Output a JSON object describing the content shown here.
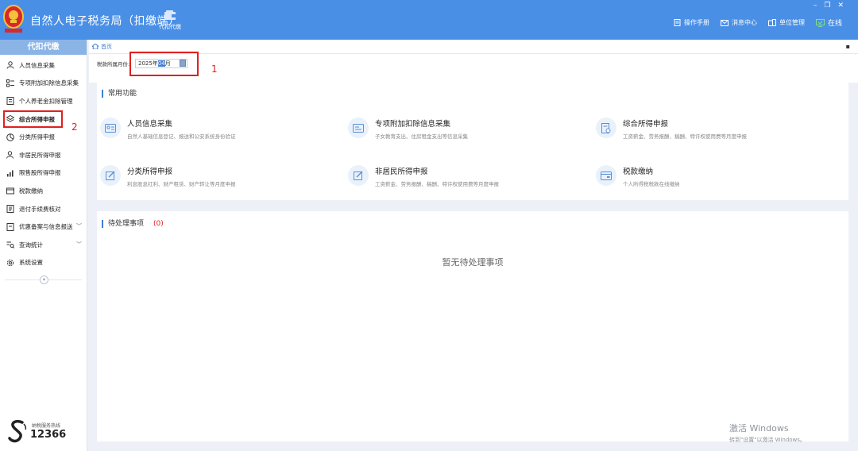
{
  "app": {
    "title": "自然人电子税务局（扣缴端）"
  },
  "topnav": {
    "label": "代扣代缴"
  },
  "toplinks": [
    {
      "label": "操作手册",
      "icon": "manual-icon"
    },
    {
      "label": "消息中心",
      "icon": "mail-icon"
    },
    {
      "label": "单位管理",
      "icon": "building-icon"
    },
    {
      "label": "在线",
      "icon": "online-monitor-icon"
    }
  ],
  "sidebar": {
    "header": "代扣代缴",
    "items": [
      {
        "label": "人员信息采集",
        "icon": "person-icon"
      },
      {
        "label": "专项附加扣除信息采集",
        "icon": "list-icon"
      },
      {
        "label": "个人养老金扣除管理",
        "icon": "pension-icon"
      },
      {
        "label": "综合所得申报",
        "icon": "layers-icon"
      },
      {
        "label": "分类所得申报",
        "icon": "category-icon"
      },
      {
        "label": "非居民所得申报",
        "icon": "nonresident-icon"
      },
      {
        "label": "限售股所得申报",
        "icon": "stock-chart-icon"
      },
      {
        "label": "税款缴纳",
        "icon": "wallet-icon"
      },
      {
        "label": "退付手续费核对",
        "icon": "refund-icon"
      },
      {
        "label": "优惠备案与信息报送",
        "icon": "document-icon",
        "caret": "﹀"
      },
      {
        "label": "查询统计",
        "icon": "query-icon",
        "caret": "﹀"
      },
      {
        "label": "系统设置",
        "icon": "gear-icon"
      }
    ],
    "collapse": "«",
    "hotline": {
      "caption": "纳税服务热线",
      "number": "12366"
    }
  },
  "breadcrumb": {
    "home": "首页"
  },
  "filter": {
    "label": "税款所属月份:",
    "year_part": "2025年",
    "month_part": "04",
    "suffix": "月"
  },
  "annotations": {
    "one": "1",
    "two": "2"
  },
  "common": {
    "title": "常用功能",
    "items": [
      {
        "name": "人员信息采集",
        "desc": "自然人基础信息登记、报送和公安系统身份验证"
      },
      {
        "name": "专项附加扣除信息采集",
        "desc": "子女教育支出、住房租金支出等信息采集"
      },
      {
        "name": "综合所得申报",
        "desc": "工资薪金、劳务报酬、稿酬、特许权使用费等月度申报"
      },
      {
        "name": "分类所得申报",
        "desc": "利息股息红利、财产租赁、财产转让等月度申报"
      },
      {
        "name": "非居民所得申报",
        "desc": "工资薪金、劳务报酬、稿酬、特许权使用费等月度申报"
      },
      {
        "name": "税款缴纳",
        "desc": "个人所得税税款在线缴纳"
      }
    ]
  },
  "pending": {
    "title": "待处理事项",
    "count": "(0)",
    "empty": "暂无待处理事项"
  },
  "watermark": {
    "line1": "激活 Windows",
    "line2": "转到\"设置\"以激活 Windows。"
  },
  "colors": {
    "header": "#4a8fe6",
    "accent": "#3d7ed8",
    "annotation": "#e02020"
  }
}
